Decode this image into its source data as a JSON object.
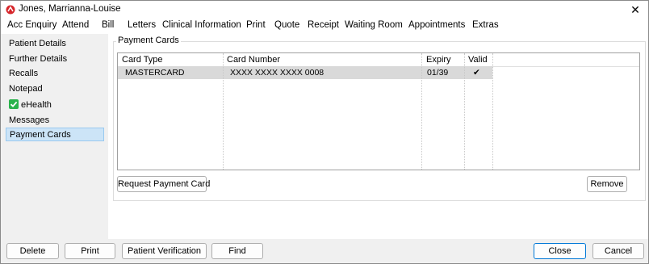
{
  "window": {
    "title": "Jones, Marrianna-Louise"
  },
  "menu": [
    "Acc Enquiry",
    "Attend",
    "Bill",
    "Letters",
    "Clinical Information",
    "Print",
    "Quote",
    "Receipt",
    "Waiting Room",
    "Appointments",
    "Extras"
  ],
  "sidebar": {
    "items": [
      {
        "label": "Patient Details"
      },
      {
        "label": "Further Details"
      },
      {
        "label": "Recalls"
      },
      {
        "label": "Notepad"
      },
      {
        "label": "eHealth",
        "icon": "check-icon",
        "icon_color": "#2bb24c"
      },
      {
        "label": "Messages"
      },
      {
        "label": "Payment Cards",
        "selected": true
      }
    ]
  },
  "payment_cards": {
    "group_label": "Payment Cards",
    "columns": [
      "Card Type",
      "Card Number",
      "Expiry",
      "Valid"
    ],
    "rows": [
      {
        "card_type": "MASTERCARD",
        "card_number": "XXXX XXXX XXXX 0008",
        "expiry": "01/39",
        "valid": "✔"
      }
    ],
    "request_button": "Request Payment Card",
    "remove_button": "Remove"
  },
  "footer": {
    "delete": "Delete",
    "print": "Print",
    "patient_verification": "Patient Verification",
    "find": "Find",
    "close": "Close",
    "cancel": "Cancel"
  },
  "colors": {
    "selection": "#cce4f7",
    "row_highlight": "#d9d9d9",
    "primary_border": "#0078d7",
    "brand_red": "#d6262b"
  }
}
